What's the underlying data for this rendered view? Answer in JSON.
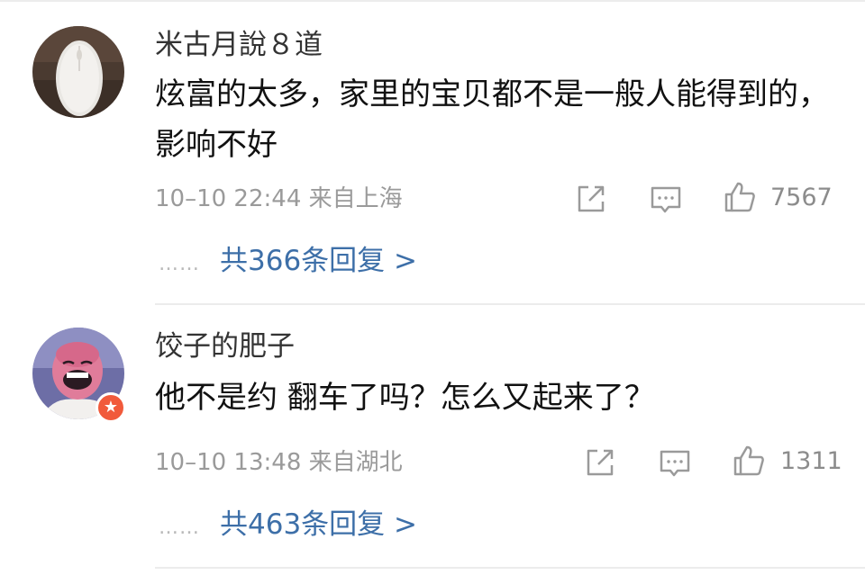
{
  "comments": [
    {
      "username": "米古月說８道",
      "text": "炫富的太多，家里的宝贝都不是一般人能得到的，影响不好",
      "time": "10–10 22:44",
      "location": "来自上海",
      "likes": "7567",
      "replies": "共366条回复 >",
      "replies_dots": "……",
      "avatar_icon": "mouse-photo-avatar"
    },
    {
      "username": "饺子的肥子",
      "text": "他不是约 翻车了吗？怎么又起来了？",
      "time": "10–10 13:48",
      "location": "来自湖北",
      "likes": "1311",
      "replies": "共463条回复 >",
      "replies_dots": "……",
      "avatar_icon": "laughing-man-avatar",
      "badge_icon": "star-badge-icon"
    }
  ],
  "icons": {
    "share": "share-icon",
    "comment": "comment-icon",
    "like": "thumbs-up-icon"
  },
  "colors": {
    "link": "#3d6fa8",
    "meta": "#9a9a9a",
    "badge": "#f15a3b"
  }
}
